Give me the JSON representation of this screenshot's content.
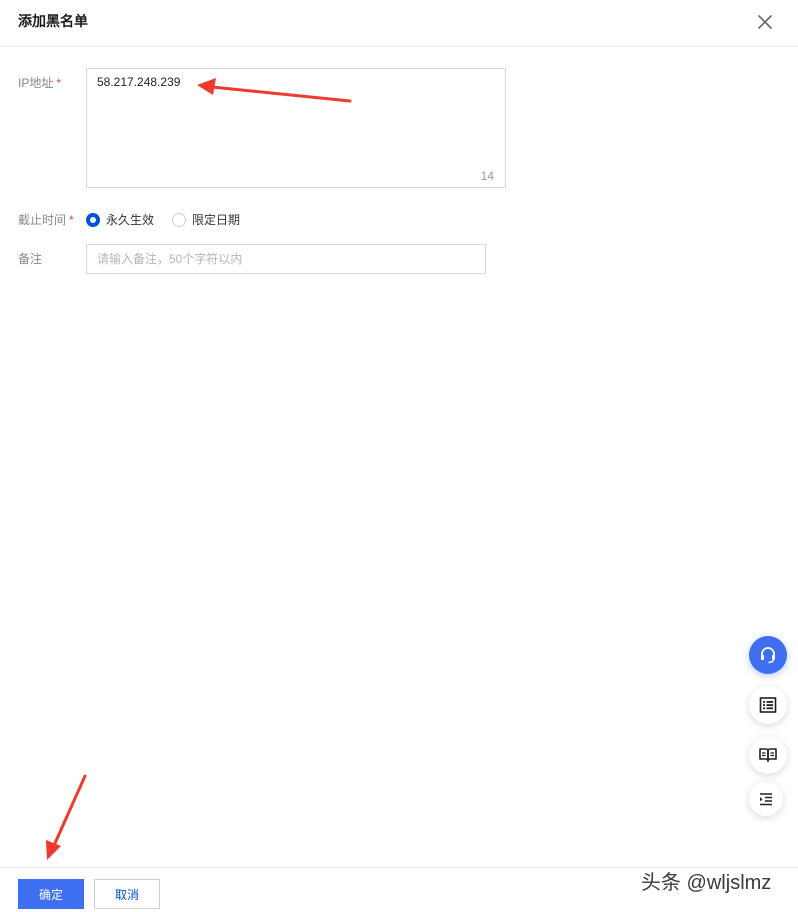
{
  "dialog": {
    "title": "添加黑名单",
    "close_icon": "close-icon"
  },
  "form": {
    "ip": {
      "label": "IP地址",
      "required_mark": "*",
      "value": "58.217.248.239",
      "char_count": "14"
    },
    "expiry": {
      "label": "截止时间",
      "required_mark": "*",
      "options": [
        {
          "label": "永久生效",
          "checked": true
        },
        {
          "label": "限定日期",
          "checked": false
        }
      ]
    },
    "remark": {
      "label": "备注",
      "placeholder": "请输入备注，50个字符以内",
      "value": ""
    }
  },
  "floating_toolbar": [
    {
      "icon": "headset-icon"
    },
    {
      "icon": "list-icon"
    },
    {
      "icon": "book-icon"
    },
    {
      "icon": "indent-icon"
    }
  ],
  "footer": {
    "confirm_label": "确定",
    "cancel_label": "取消"
  },
  "watermark": "头条 @wljslmz",
  "colors": {
    "primary": "#3d6ff0",
    "required": "#e54545",
    "annotation_arrow": "#f03a2e"
  }
}
